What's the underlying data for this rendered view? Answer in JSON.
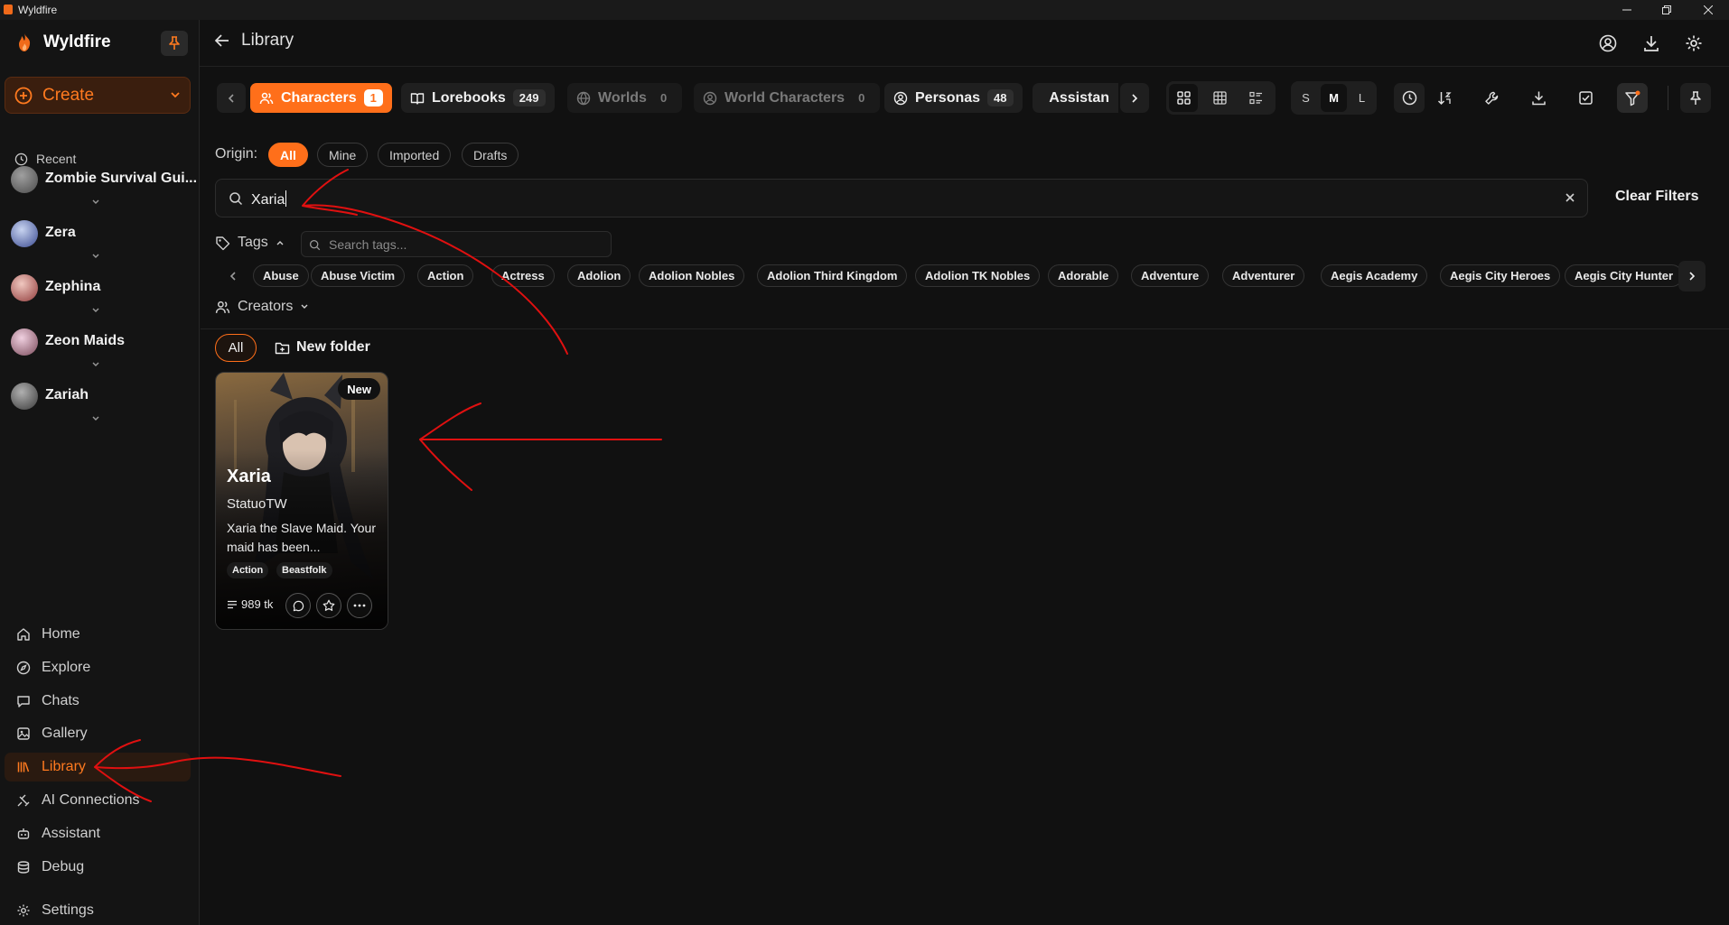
{
  "window": {
    "title": "Wyldfire"
  },
  "sidebar": {
    "brand": "Wyldfire",
    "create_label": "Create",
    "recent_label": "Recent",
    "recent": [
      {
        "name": "Zombie Survival Gui...",
        "color": "#7d7d7d"
      },
      {
        "name": "Zera",
        "color": "#5a6fb0"
      },
      {
        "name": "Zephina",
        "color": "#b05a5a"
      },
      {
        "name": "Zeon Maids",
        "color": "#a86a7a"
      },
      {
        "name": "Zariah",
        "color": "#6a6a6a"
      }
    ],
    "nav": [
      {
        "label": "Home",
        "icon": "home-icon"
      },
      {
        "label": "Explore",
        "icon": "compass-icon"
      },
      {
        "label": "Chats",
        "icon": "chat-icon"
      },
      {
        "label": "Gallery",
        "icon": "image-icon"
      },
      {
        "label": "Library",
        "icon": "library-icon",
        "active": true
      },
      {
        "label": "AI Connections",
        "icon": "ai-connections-icon"
      },
      {
        "label": "Assistant",
        "icon": "bot-icon"
      },
      {
        "label": "Debug",
        "icon": "database-icon"
      }
    ],
    "settings_label": "Settings"
  },
  "header": {
    "title": "Library"
  },
  "tabs": [
    {
      "label": "Characters",
      "count": "1"
    },
    {
      "label": "Lorebooks",
      "count": "249"
    },
    {
      "label": "Worlds",
      "count": "0"
    },
    {
      "label": "World Characters",
      "count": "0"
    },
    {
      "label": "Personas",
      "count": "48"
    },
    {
      "label": "Assistan"
    }
  ],
  "size_toggle": [
    "S",
    "M",
    "L"
  ],
  "origin": {
    "label": "Origin:",
    "options": [
      "All",
      "Mine",
      "Imported",
      "Drafts"
    ]
  },
  "search": {
    "value": "Xaria",
    "clear_filters": "Clear Filters"
  },
  "tags": {
    "label": "Tags",
    "search_placeholder": "Search tags...",
    "items": [
      "Abuse",
      "Abuse Victim",
      "Action",
      "Actress",
      "Adolion",
      "Adolion Nobles",
      "Adolion Third Kingdom",
      "Adolion TK Nobles",
      "Adorable",
      "Adventure",
      "Adventurer",
      "Aegis Academy",
      "Aegis City Heroes",
      "Aegis City Hunter"
    ]
  },
  "creators": {
    "label": "Creators"
  },
  "folders": {
    "all": "All",
    "new_folder": "New folder"
  },
  "card": {
    "badge": "New",
    "name": "Xaria",
    "creator": "StatuoTW",
    "description": "Xaria the Slave Maid. Your maid has been...",
    "tags": [
      "Action",
      "Beastfolk"
    ],
    "tokens": "989 tk"
  },
  "colors": {
    "accent": "#ff6f1a",
    "annotation": "#e01010",
    "background": "#111111"
  }
}
